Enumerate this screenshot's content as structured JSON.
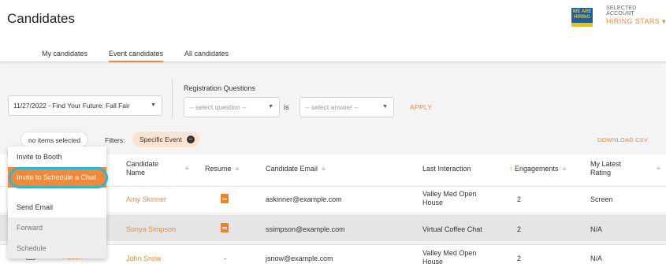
{
  "header": {
    "title": "Candidates",
    "account_label": "SELECTED ACCOUNT",
    "account_name": "HIRING STARS ▾",
    "logo_text": "WE ARE HIRING"
  },
  "tabs": [
    {
      "label": "My candidates",
      "active": false
    },
    {
      "label": "Event candidates",
      "active": true
    },
    {
      "label": "All candidates",
      "active": false
    }
  ],
  "filters": {
    "event_select": "11/27/2022 - Find Your Future: Fall Fair",
    "registration_label": "Registration Questions",
    "question_placeholder": "-- select question --",
    "is_text": "is",
    "answer_placeholder": "-- select answer --",
    "apply_label": "APPLY"
  },
  "filter_bar": {
    "selected_text": "no items selected",
    "filters_label": "Filters:",
    "active_filter": "Specific Event",
    "download_label": "DOWNLOAD CSV"
  },
  "table": {
    "columns": [
      "Candidate Name",
      "Resume",
      "Candidate Email",
      "Last Interaction",
      "Engagements",
      "My Latest Rating"
    ],
    "rows": [
      {
        "name": "Amy Skinner",
        "resume": "document-icon",
        "email": "askinner@example.com",
        "last_interaction": "Valley Med Open House",
        "engagements": "2",
        "rating": "Screen"
      },
      {
        "name": "Sonya Simpson",
        "resume": "document-icon",
        "email": "ssimpson@example.com",
        "last_interaction": "Virtual Coffee Chat",
        "engagements": "2",
        "rating": "N/A"
      },
      {
        "name": "John Snow",
        "resume": "-",
        "email": "jsnow@example.com",
        "last_interaction": "Valley Med Open House",
        "engagements": "2",
        "rating": "N/A"
      }
    ],
    "row_action_label": "Action ▾"
  },
  "menu": {
    "items": [
      {
        "label": "Invite to Booth",
        "state": "normal"
      },
      {
        "label": "Invite to Schedule a Chat",
        "state": "highlighted"
      },
      {
        "label": "Send Email",
        "state": "normal"
      },
      {
        "label": "Forward",
        "state": "disabled"
      },
      {
        "label": "Schedule",
        "state": "disabled"
      }
    ]
  },
  "colors": {
    "accent": "#f0893a",
    "highlight_ring": "#2bb6d8",
    "logo_blue": "#1f5e9e",
    "logo_yellow": "#f2c200"
  }
}
